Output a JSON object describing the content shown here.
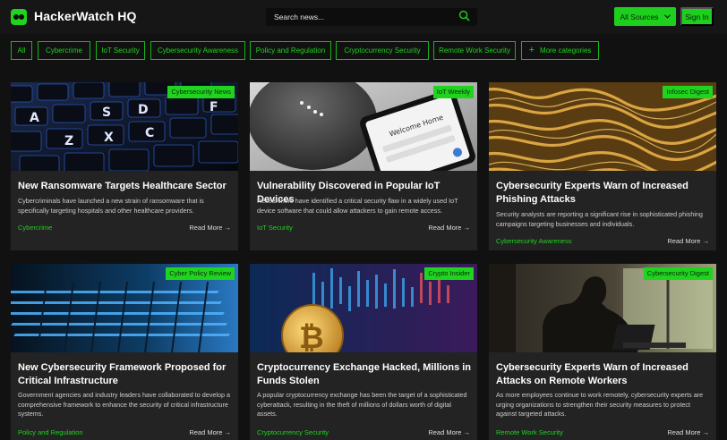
{
  "header": {
    "brand": "HackerWatch HQ",
    "search_placeholder": "Search news...",
    "sources_label": "All Sources",
    "signin_label": "Sign In"
  },
  "colors": {
    "accent": "#1fd31f",
    "background": "#111111",
    "card": "#232323"
  },
  "categories": [
    "All",
    "Cybercrime",
    "IoT Security",
    "Cybersecurity Awareness",
    "Policy and Regulation",
    "Cryptocurrency Security",
    "Remote Work Security",
    "More categories"
  ],
  "articles": [
    {
      "source": "Cybersecurity News",
      "title": "New Ransomware Targets Healthcare Sector",
      "summary": "Cybercriminals have launched a new strain of ransomware that is specifically targeting hospitals and other healthcare providers.",
      "category": "Cybercrime",
      "read_more": "Read More →",
      "image": "keyboard-photo"
    },
    {
      "source": "IoT Weekly",
      "title": "Vulnerability Discovered in Popular IoT Devices",
      "summary": "Researchers have identified a critical security flaw in a widely used IoT device software that could allow attackers to gain remote access.",
      "category": "IoT Security",
      "read_more": "Read More →",
      "image": "smart-speaker-photo"
    },
    {
      "source": "Infosec Digest",
      "title": "Cybersecurity Experts Warn of Increased Phishing Attacks",
      "summary": "Security analysts are reporting a significant rise in sophisticated phishing campaigns targeting businesses and individuals.",
      "category": "Cybersecurity Awareness",
      "read_more": "Read More →",
      "image": "chain-photo"
    },
    {
      "source": "Cyber Policy Review",
      "title": "New Cybersecurity Framework Proposed for Critical Infrastructure",
      "summary": "Government agencies and industry leaders have collaborated to develop a comprehensive framework to enhance the security of critical infrastructure systems.",
      "category": "Policy and Regulation",
      "read_more": "Read More →",
      "image": "laptop-keyboard-photo"
    },
    {
      "source": "Crypto Insider",
      "title": "Cryptocurrency Exchange Hacked, Millions in Funds Stolen",
      "summary": "A popular cryptocurrency exchange has been the target of a sophisticated cyberattack, resulting in the theft of millions of dollars worth of digital assets.",
      "category": "Cryptocurrency Security",
      "read_more": "Read More →",
      "image": "bitcoin-photo"
    },
    {
      "source": "Cybersecurity Digest",
      "title": "Cybersecurity Experts Warn of Increased Attacks on Remote Workers",
      "summary": "As more employees continue to work remotely, cybersecurity experts are urging organizations to strengthen their security measures to protect against targeted attacks.",
      "category": "Remote Work Security",
      "read_more": "Read More →",
      "image": "remote-worker-photo"
    }
  ]
}
